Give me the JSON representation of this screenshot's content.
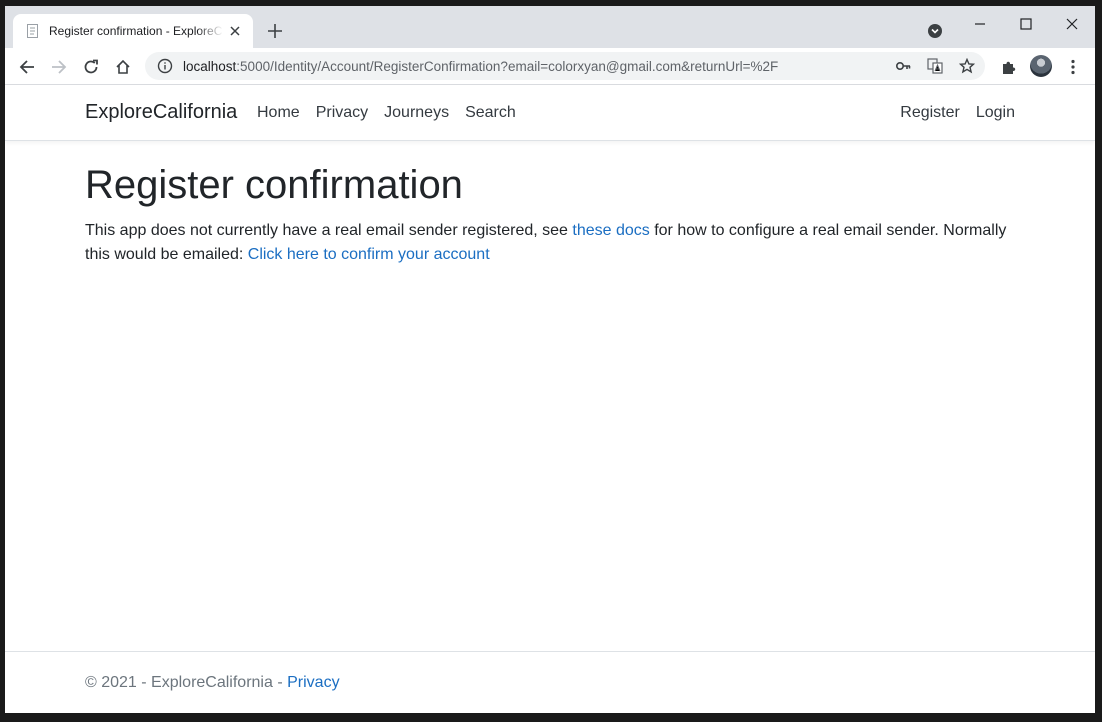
{
  "browser": {
    "tab_title": "Register confirmation - ExploreCalifornia",
    "url_host": "localhost",
    "url_rest": ":5000/Identity/Account/RegisterConfirmation?email=colorxyan@gmail.com&returnUrl=%2F"
  },
  "nav": {
    "brand": "ExploreCalifornia",
    "links": [
      "Home",
      "Privacy",
      "Journeys",
      "Search"
    ],
    "register": "Register",
    "login": "Login"
  },
  "main": {
    "title": "Register confirmation",
    "text_before_docs": "This app does not currently have a real email sender registered, see ",
    "docs_link": "these docs",
    "text_after_docs": " for how to configure a real email sender. Normally this would be emailed: ",
    "confirm_link": "Click here to confirm your account"
  },
  "footer": {
    "copyright": "© 2021 - ExploreCalifornia - ",
    "privacy_link": "Privacy"
  },
  "colors": {
    "link": "#1b6ec2",
    "text": "#212529",
    "tabstrip": "#dee1e6"
  }
}
